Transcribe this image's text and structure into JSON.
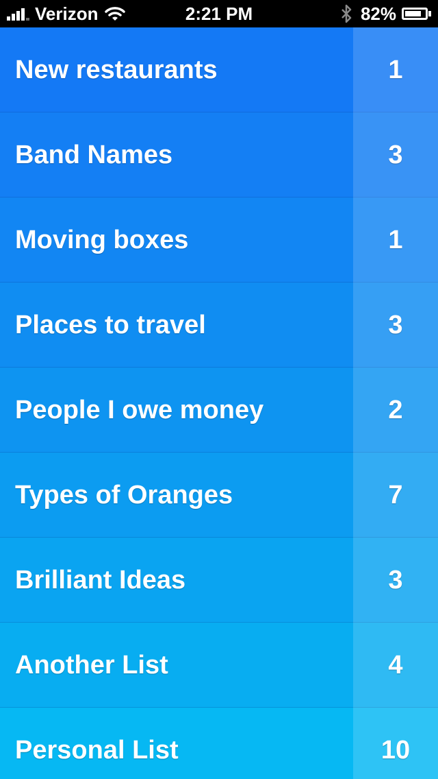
{
  "status_bar": {
    "carrier": "Verizon",
    "time": "2:21 PM",
    "battery_percent": "82%",
    "battery_level": 0.82,
    "signal_bars_filled": 4,
    "icons": [
      "signal-bars-icon",
      "wifi-icon",
      "bluetooth-icon",
      "battery-icon"
    ]
  },
  "lists": [
    {
      "title": "New restaurants",
      "count": "1",
      "color": "#1479F5"
    },
    {
      "title": "Band Names",
      "count": "3",
      "color": "#147FF4"
    },
    {
      "title": "Moving boxes",
      "count": "1",
      "color": "#1286F3"
    },
    {
      "title": "Places to travel",
      "count": "3",
      "color": "#108DF2"
    },
    {
      "title": "People I owe money",
      "count": "2",
      "color": "#0E94F1"
    },
    {
      "title": "Types of Oranges",
      "count": "7",
      "color": "#0C9CF1"
    },
    {
      "title": "Brilliant Ideas",
      "count": "3",
      "color": "#0AA4F1"
    },
    {
      "title": "Another List",
      "count": "4",
      "color": "#08ADF1"
    },
    {
      "title": "Personal List",
      "count": "10",
      "color": "#06B8F3"
    }
  ]
}
